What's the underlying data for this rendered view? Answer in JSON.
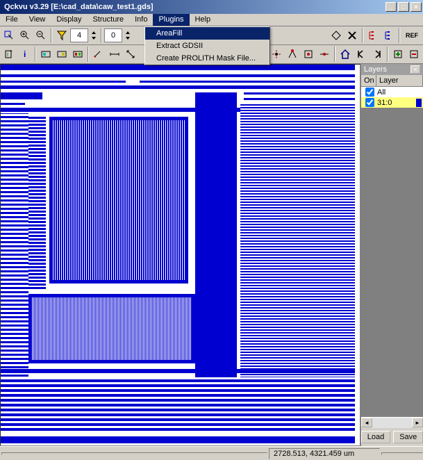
{
  "window": {
    "title": "Qckvu v3.29 [E:\\cad_data\\caw_test1.gds]"
  },
  "menu": {
    "items": [
      "File",
      "View",
      "Display",
      "Structure",
      "Info",
      "Plugins",
      "Help"
    ],
    "active_index": 5
  },
  "plugins_menu": {
    "items": [
      {
        "label": "AreaFill",
        "highlighted": true
      },
      {
        "label": "Extract GDSII",
        "highlighted": false
      },
      {
        "label": "Create PROLITH Mask File...",
        "highlighted": false
      }
    ]
  },
  "toolbar1": {
    "input_levels": "4",
    "input_zero": "0"
  },
  "layers_panel": {
    "title": "Layers",
    "col_on": "On",
    "col_layer": "Layer",
    "rows": [
      {
        "on": true,
        "label": "All",
        "selected": false
      },
      {
        "on": true,
        "label": "31:0",
        "selected": true
      }
    ],
    "load": "Load",
    "save": "Save"
  },
  "status": {
    "coords": "2728.513, 4321.459 um"
  },
  "icons": {
    "minimize": "_",
    "maximize": "□",
    "close": "×",
    "ref": "REF"
  }
}
